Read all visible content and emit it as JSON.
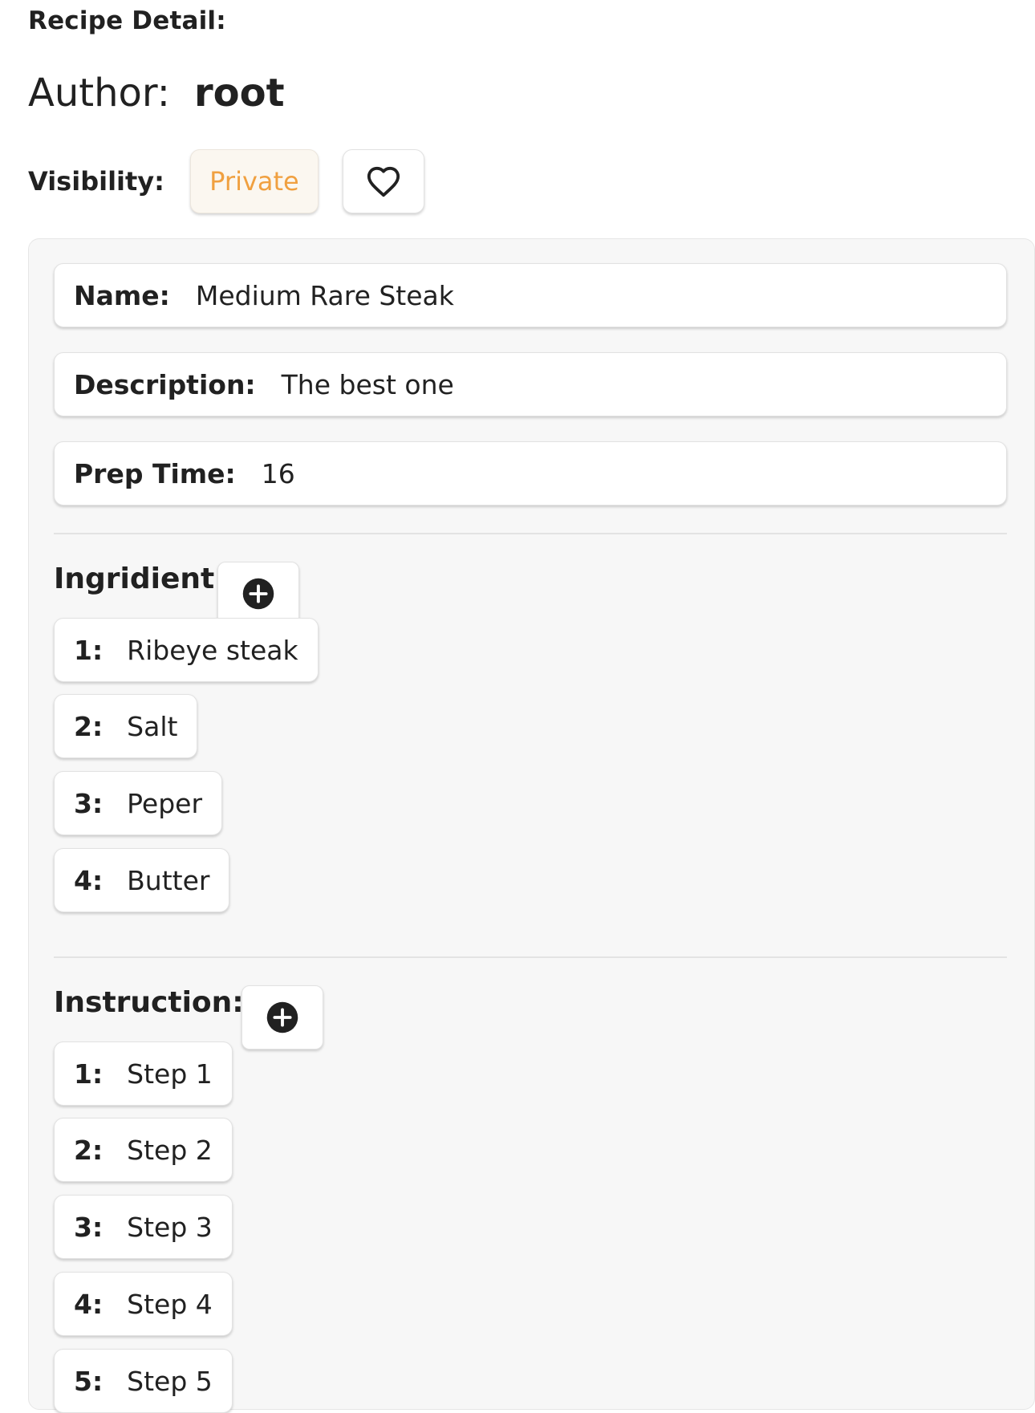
{
  "header": {
    "section_label": "Recipe Detail:",
    "author_label": "Author:",
    "author_value": "root"
  },
  "visibility": {
    "label": "Visibility:",
    "value": "Private",
    "favorite_icon": "heart-outline-icon"
  },
  "details": {
    "name_label": "Name:",
    "name_value": "Medium Rare Steak",
    "description_label": "Description:",
    "description_value": "The best one",
    "prep_time_label": "Prep Time:",
    "prep_time_value": "16"
  },
  "ingredients": {
    "title": "Ingridient:",
    "add_icon": "plus-circle-icon",
    "items": [
      {
        "num": "1:",
        "text": "Ribeye steak"
      },
      {
        "num": "2:",
        "text": "Salt"
      },
      {
        "num": "3:",
        "text": "Peper"
      },
      {
        "num": "4:",
        "text": "Butter"
      }
    ]
  },
  "instructions": {
    "title": "Instruction:",
    "add_icon": "plus-circle-icon",
    "items": [
      {
        "num": "1:",
        "text": "Step 1"
      },
      {
        "num": "2:",
        "text": "Step 2"
      },
      {
        "num": "3:",
        "text": "Step 3"
      },
      {
        "num": "4:",
        "text": "Step 4"
      },
      {
        "num": "5:",
        "text": "Step 5"
      }
    ]
  },
  "colors": {
    "private_badge_text": "#f0a040",
    "private_badge_bg": "#fbf7f0",
    "card_bg": "#f7f7f7",
    "icon_dark": "#212121"
  }
}
